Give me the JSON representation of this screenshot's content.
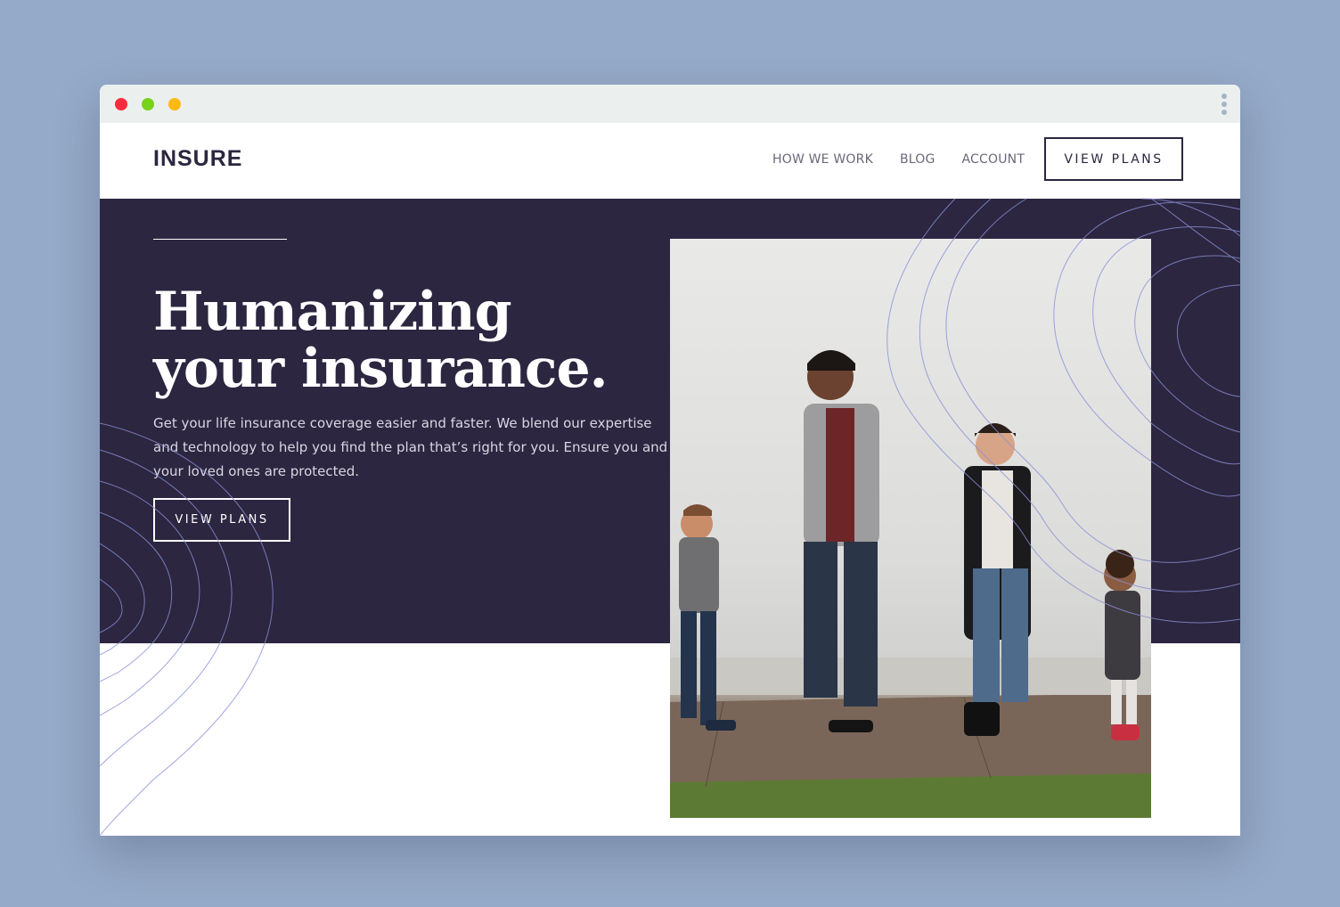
{
  "window": {
    "controls": [
      "close",
      "minimize",
      "maximize"
    ],
    "menu_icon": "kebab-icon"
  },
  "brand": {
    "logo": "INSURE"
  },
  "nav": {
    "links": [
      "HOW WE WORK",
      "BLOG",
      "ACCOUNT"
    ],
    "cta": "VIEW PLANS"
  },
  "hero": {
    "title": "Humanizing your insurance.",
    "text": "Get your life insurance coverage easier and faster. We blend our expertise and technology to help you find the plan that’s right for you. Ensure you and your loved ones are protected.",
    "cta": "VIEW PLANS"
  },
  "colors": {
    "page_bg": "#95a9c8",
    "hero_bg": "#2c2640",
    "text_dark": "#2c2640",
    "curve": "#8a8fd6"
  }
}
